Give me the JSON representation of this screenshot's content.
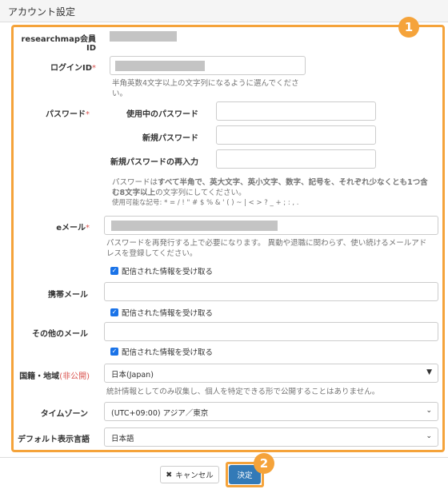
{
  "header": {
    "title": "アカウント設定"
  },
  "badges": {
    "one": "1",
    "two": "2"
  },
  "form": {
    "researchmap_id": {
      "label_line1": "researchmap会員",
      "label_line2": "ID"
    },
    "login_id": {
      "label": "ログインID",
      "required_mark": "*",
      "help_line1": "半角英数4文字以上の文字列になるように選んでくださ",
      "help_line2": "い。"
    },
    "password": {
      "label": "パスワード",
      "required_mark": "*",
      "current_label": "使用中のパスワード",
      "new_label": "新規パスワード",
      "confirm_label": "新規パスワードの再入力",
      "help_line1_a": "パスワードは",
      "help_line1_b": "すべて半角で、英大文字、英小文字、数字、記号を、それぞれ少なくとも1つ含",
      "help_line2_a": "む8文字以上",
      "help_line2_b": "の文字列にしてください。",
      "help_line3": "使用可能な記号: * = / ! \" # $ % & ' ( ) ~ | < > ? _ + ; : , ."
    },
    "email": {
      "label": "eメール",
      "required_mark": "*",
      "help_line1": "パスワードを再発行する上で必要になります。 異動や退職に関わらず、使い続けるメールアド",
      "help_line2": "レスを登録してください。",
      "checkbox_label": "配信された情報を受け取る"
    },
    "mobile_email": {
      "label": "携帯メール",
      "checkbox_label": "配信された情報を受け取る"
    },
    "other_email": {
      "label": "その他のメール",
      "checkbox_label": "配信された情報を受け取る"
    },
    "nationality": {
      "label": "国籍・地域",
      "private_note": "(非公開)",
      "value": "日本(Japan)",
      "help": "統計情報としてのみ収集し、個人を特定できる形で公開することはありません。"
    },
    "timezone": {
      "label": "タイムゾーン",
      "value": "(UTC+09:00) アジア／東京"
    },
    "language": {
      "label": "デフォルト表示言語",
      "value": "日本語"
    }
  },
  "footer": {
    "cancel_label": "キャンセル",
    "submit_label": "決定"
  },
  "colors": {
    "highlight": "#f5a33a",
    "primary": "#337ab7",
    "required": "#d9534f"
  }
}
